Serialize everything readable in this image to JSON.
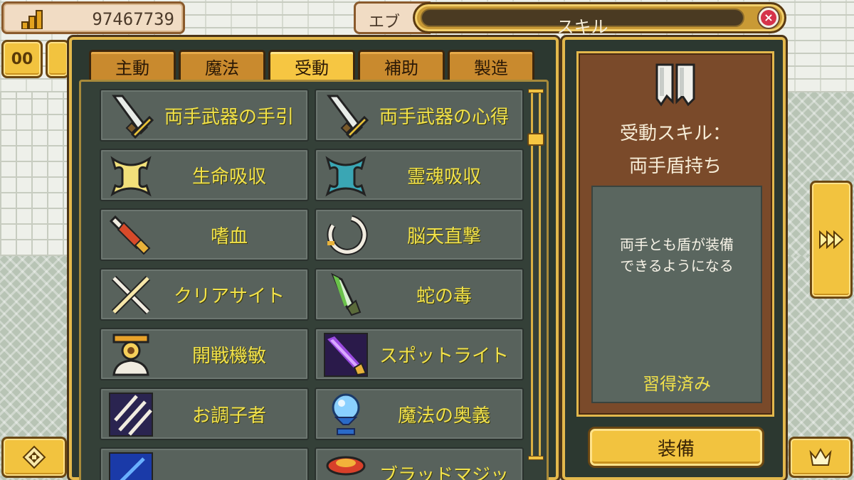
{
  "hud": {
    "gold_value": "97467739",
    "gold_icon": "bars-icon",
    "right_partial": "エブ",
    "window_title": "スキル",
    "close_icon": "close-icon"
  },
  "tabs": [
    {
      "label": "主動",
      "active": false
    },
    {
      "label": "魔法",
      "active": false
    },
    {
      "label": "受動",
      "active": true
    },
    {
      "label": "補助",
      "active": false
    },
    {
      "label": "製造",
      "active": false
    }
  ],
  "skills": [
    {
      "label": "両手武器の手引",
      "icon": "sword-icon"
    },
    {
      "label": "両手武器の心得",
      "icon": "sword-icon"
    },
    {
      "label": "生命吸収",
      "icon": "life-drain-icon"
    },
    {
      "label": "霊魂吸収",
      "icon": "soul-drain-icon"
    },
    {
      "label": "嗜血",
      "icon": "bloodthirst-icon"
    },
    {
      "label": "脳天直撃",
      "icon": "ring-strike-icon"
    },
    {
      "label": "クリアサイト",
      "icon": "crossed-swords-icon"
    },
    {
      "label": "蛇の毒",
      "icon": "poison-dagger-icon"
    },
    {
      "label": "開戦機敏",
      "icon": "hourglass-icon"
    },
    {
      "label": "スポットライト",
      "icon": "spotlight-icon"
    },
    {
      "label": "お調子者",
      "icon": "slash-icon"
    },
    {
      "label": "魔法の奥義",
      "icon": "crystal-goblet-icon"
    },
    {
      "label": "",
      "icon": "blue-icon"
    },
    {
      "label": "ブラッドマジッ",
      "icon": "red-icon"
    }
  ],
  "detail": {
    "icon": "shield-banner-icon",
    "type_label": "受動スキル：",
    "skill_name": "両手盾持ち",
    "description": "両手とも盾が装備\nできるようになる",
    "status": "習得済み",
    "equip_label": "装備"
  },
  "side_buttons": {
    "pause_label": "00",
    "next_icon": "fast-forward-icon",
    "dpad_icon": "dpad-icon",
    "crown_icon": "crown-icon"
  }
}
